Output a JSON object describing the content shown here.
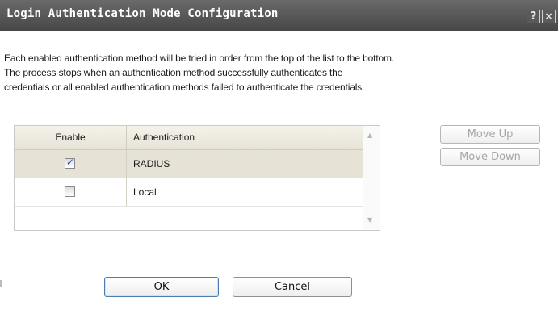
{
  "dialog": {
    "title": "Login Authentication Mode Configuration",
    "help_glyph": "?",
    "close_glyph": "×",
    "description_lines": [
      "Each enabled authentication method will be tried in order from the top of the list to the bottom.",
      "The process stops when an authentication method successfully authenticates the",
      "credentials or all enabled authentication methods failed to authenticate the credentials."
    ]
  },
  "table": {
    "columns": [
      "Enable",
      "Authentication"
    ],
    "rows": [
      {
        "enabled": true,
        "name": "RADIUS",
        "selected": true
      },
      {
        "enabled": false,
        "name": "Local",
        "selected": false
      }
    ],
    "scroll_up_glyph": "▲",
    "scroll_down_glyph": "▼"
  },
  "buttons": {
    "move_up": "Move Up",
    "move_down": "Move Down",
    "ok": "OK",
    "cancel": "Cancel"
  },
  "colors": {
    "titlebar": "#555555",
    "selected_row": "#e6e2d6",
    "checkbox_tick": "#2d4fb0"
  },
  "icons": {
    "help": "help-icon",
    "close": "close-icon",
    "check": "checkmark-icon"
  }
}
